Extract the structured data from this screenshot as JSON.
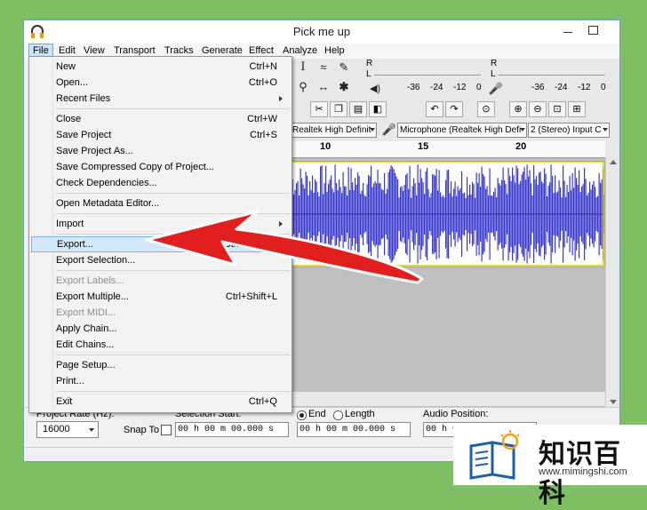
{
  "window": {
    "title": "Pick me up"
  },
  "menubar": [
    "File",
    "Edit",
    "View",
    "Transport",
    "Tracks",
    "Generate",
    "Effect",
    "Analyze",
    "Help"
  ],
  "file_menu": [
    {
      "label": "New",
      "shortcut": "Ctrl+N",
      "enabled": true
    },
    {
      "label": "Open...",
      "shortcut": "Ctrl+O",
      "enabled": true
    },
    {
      "label": "Recent Files",
      "shortcut": "",
      "enabled": true,
      "submenu": true
    },
    {
      "separator": true
    },
    {
      "label": "Close",
      "shortcut": "Ctrl+W",
      "enabled": true
    },
    {
      "label": "Save Project",
      "shortcut": "Ctrl+S",
      "enabled": true
    },
    {
      "label": "Save Project As...",
      "shortcut": "",
      "enabled": true
    },
    {
      "label": "Save Compressed Copy of Project...",
      "shortcut": "",
      "enabled": true
    },
    {
      "label": "Check Dependencies...",
      "shortcut": "",
      "enabled": true
    },
    {
      "separator": true
    },
    {
      "label": "Open Metadata Editor...",
      "shortcut": "",
      "enabled": true
    },
    {
      "separator": true
    },
    {
      "label": "Import",
      "shortcut": "",
      "enabled": true,
      "submenu": true
    },
    {
      "separator": true
    },
    {
      "label": "Export...",
      "shortcut": "Ctrl+Shift+E",
      "enabled": true,
      "highlighted": true
    },
    {
      "label": "Export Selection...",
      "shortcut": "",
      "enabled": true
    },
    {
      "separator": true
    },
    {
      "label": "Export Labels...",
      "shortcut": "",
      "enabled": false
    },
    {
      "label": "Export Multiple...",
      "shortcut": "Ctrl+Shift+L",
      "enabled": true
    },
    {
      "label": "Export MIDI...",
      "shortcut": "",
      "enabled": false
    },
    {
      "label": "Apply Chain...",
      "shortcut": "",
      "enabled": true
    },
    {
      "label": "Edit Chains...",
      "shortcut": "",
      "enabled": true
    },
    {
      "separator": true
    },
    {
      "label": "Page Setup...",
      "shortcut": "",
      "enabled": true
    },
    {
      "label": "Print...",
      "shortcut": "",
      "enabled": true
    },
    {
      "separator": true
    },
    {
      "label": "Exit",
      "shortcut": "Ctrl+Q",
      "enabled": true
    }
  ],
  "meters": {
    "record_channels": [
      "R",
      "L",
      "R"
    ],
    "play_ticks": [
      "-36",
      "-24",
      "-12",
      "0"
    ],
    "rec_ticks": [
      "-36",
      "-24",
      "-12",
      "0"
    ]
  },
  "devices": {
    "playback": "Realtek High Definit",
    "recording": "Microphone (Realtek High Defi",
    "channels": "2 (Stereo) Input C"
  },
  "ruler_ticks": [
    "10",
    "15",
    "20"
  ],
  "bottom": {
    "project_rate_label": "Project Rate (Hz):",
    "project_rate_value": "16000",
    "snap_to_label": "Snap To",
    "selection_start_label": "Selection Start:",
    "end_label": "End",
    "length_label": "Length",
    "audio_position_label": "Audio Position:",
    "time_start": "00 h 00 m 00.000 s",
    "time_end": "00 h 00 m 00.000 s",
    "time_pos": "00 h 00 m 00.000 s"
  },
  "watermark": {
    "title": "知识百科",
    "url": "www.mimingshi.com"
  },
  "colors": {
    "waveform": "#3838cc",
    "arrow": "#e21f1f",
    "menu_highlight": "#d5e8fa",
    "background": "#7fbf64"
  }
}
